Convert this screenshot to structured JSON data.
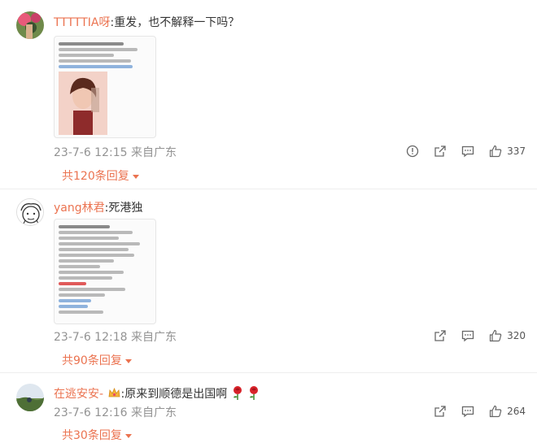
{
  "comments": [
    {
      "username": "TTTTTIA呀",
      "text": ":重发，也不解释一下吗？",
      "timestamp": "23-7-6 12:15",
      "location": "来自广东",
      "likes": "337",
      "replies": "共120条回复"
    },
    {
      "username": "yang林君",
      "text": ":死港独",
      "timestamp": "23-7-6 12:18",
      "location": "来自广东",
      "likes": "320",
      "replies": "共90条回复"
    },
    {
      "username": "在逃安安-",
      "text": ":原来到顺德是出国啊",
      "timestamp": "23-7-6 12:16",
      "location": "来自广东",
      "likes": "264",
      "replies": "共30条回复"
    }
  ],
  "icons": [
    "report-icon",
    "share-icon",
    "comment-icon",
    "like-icon",
    "crown-emoji",
    "rose-emoji"
  ],
  "colors": {
    "accent": "#eb7350",
    "meta": "#939393",
    "text": "#333333"
  }
}
